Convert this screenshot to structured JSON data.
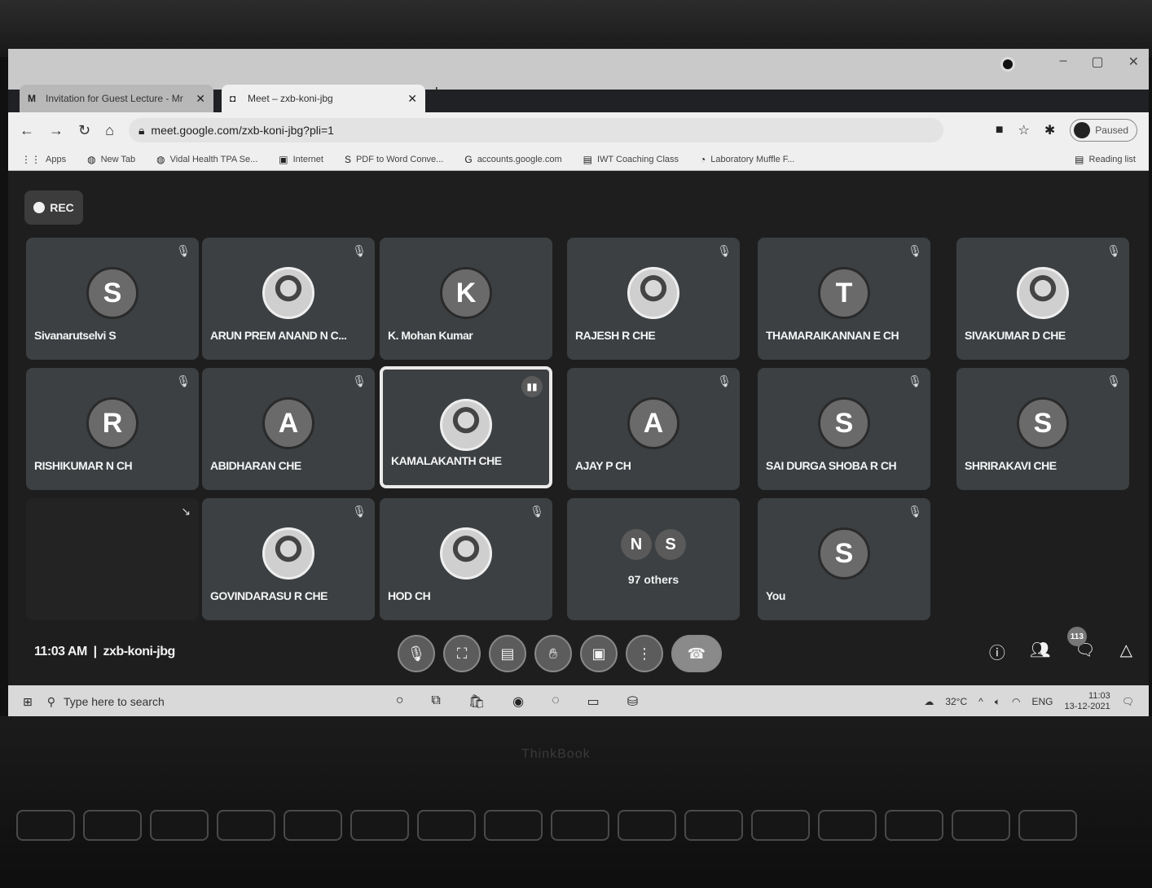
{
  "browser": {
    "tabs": [
      {
        "title": "Invitation for Guest Lecture - Mr",
        "icon": "gmail-icon",
        "favicon_char": "M"
      },
      {
        "title": "Meet – zxb-koni-jbg",
        "icon": "meet-icon",
        "favicon_char": "◘"
      }
    ],
    "url": "meet.google.com/zxb-koni-jbg?pli=1",
    "profile_label": "Paused",
    "bookmarks": [
      {
        "label": "Apps",
        "icon": "apps-grid-icon",
        "glyph": "⋮⋮"
      },
      {
        "label": "New Tab",
        "icon": "globe-icon",
        "glyph": "◍"
      },
      {
        "label": "Vidal Health TPA Se...",
        "icon": "globe-icon",
        "glyph": "◍"
      },
      {
        "label": "Internet",
        "icon": "bookmark-icon",
        "glyph": "▣"
      },
      {
        "label": "PDF to Word Conve...",
        "icon": "pdf-icon",
        "glyph": "S"
      },
      {
        "label": "accounts.google.com",
        "icon": "google-icon",
        "glyph": "G"
      },
      {
        "label": "IWT Coaching Class",
        "icon": "page-icon",
        "glyph": "▤"
      },
      {
        "label": "Laboratory Muffle F...",
        "icon": "page-icon",
        "glyph": "◔"
      }
    ],
    "reading_list": "Reading list"
  },
  "meet": {
    "rec_label": "REC",
    "participants": [
      {
        "name": "Sivanarutselvi S",
        "initial": "S",
        "photo": false,
        "muted": true
      },
      {
        "name": "ARUN PREM ANAND N C...",
        "initial": "",
        "photo": true,
        "muted": true
      },
      {
        "name": "K. Mohan Kumar",
        "initial": "K",
        "photo": false,
        "muted": false
      },
      {
        "name": "RAJESH R CHE",
        "initial": "",
        "photo": true,
        "muted": true
      },
      {
        "name": "THAMARAIKANNAN E CH",
        "initial": "T",
        "photo": false,
        "muted": true
      },
      {
        "name": "SIVAKUMAR D CHE",
        "initial": "",
        "photo": true,
        "muted": true
      },
      {
        "name": "RISHIKUMAR N CH",
        "initial": "R",
        "photo": false,
        "muted": true
      },
      {
        "name": "ABIDHARAN CHE",
        "initial": "A",
        "photo": false,
        "muted": true
      },
      {
        "name": "KAMALAKANTH CHE",
        "initial": "",
        "photo": true,
        "muted": false,
        "speaking": true
      },
      {
        "name": "AJAY P CH",
        "initial": "A",
        "photo": false,
        "muted": true
      },
      {
        "name": "SAI DURGA SHOBA R CH",
        "initial": "S",
        "photo": false,
        "muted": true
      },
      {
        "name": "SHRIRAKAVI CHE",
        "initial": "S",
        "photo": false,
        "muted": true
      },
      {
        "name": "",
        "initial": "",
        "photo": false,
        "muted": false,
        "blank": true
      },
      {
        "name": "GOVINDARASU R CHE",
        "initial": "",
        "photo": true,
        "muted": true
      },
      {
        "name": "HOD CH",
        "initial": "",
        "photo": true,
        "muted": true
      },
      {
        "name": "97 others",
        "initial": "",
        "others": [
          "N",
          "S"
        ]
      },
      {
        "name": "You",
        "initial": "S",
        "photo": false,
        "muted": true
      }
    ],
    "meeting_time": "11:03 AM",
    "meeting_code": "zxb-koni-jbg",
    "participant_count": "113",
    "controls": [
      "mic-off-icon",
      "camera-off-icon",
      "captions-icon",
      "raise-hand-icon",
      "present-icon",
      "more-icon",
      "hang-up-icon"
    ],
    "right_controls": [
      "info-icon",
      "people-icon",
      "chat-icon",
      "activities-icon"
    ]
  },
  "taskbar": {
    "search_placeholder": "Type here to search",
    "weather": "32°C",
    "language": "ENG",
    "time": "11:03",
    "date": "13-12-2021"
  },
  "laptop": {
    "brand": "ThinkBook"
  }
}
